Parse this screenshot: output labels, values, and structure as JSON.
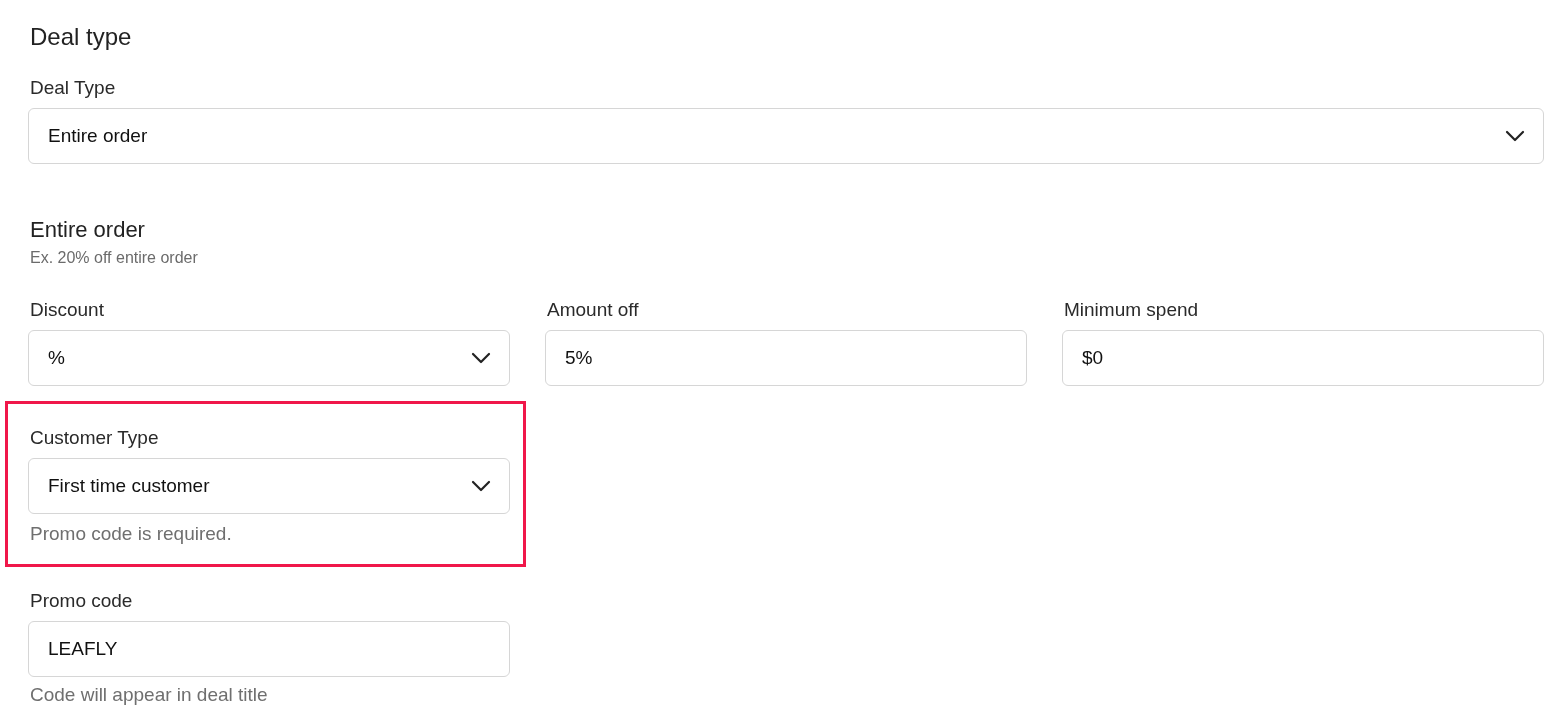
{
  "section_title": "Deal type",
  "deal_type": {
    "label": "Deal Type",
    "value": "Entire order"
  },
  "subsection": {
    "title": "Entire order",
    "hint": "Ex. 20% off entire order"
  },
  "fields": [
    {
      "kind": "select",
      "label": "Discount",
      "value": "%"
    },
    {
      "kind": "input",
      "label": "Amount off",
      "value": "5%"
    },
    {
      "kind": "input",
      "label": "Minimum spend",
      "value": "$0"
    }
  ],
  "customer_type": {
    "label": "Customer Type",
    "value": "First time customer",
    "helper": "Promo code is required.",
    "highlighted": true
  },
  "promo_code": {
    "label": "Promo code",
    "value": "LEAFLY",
    "helper": "Code will appear in deal title"
  }
}
